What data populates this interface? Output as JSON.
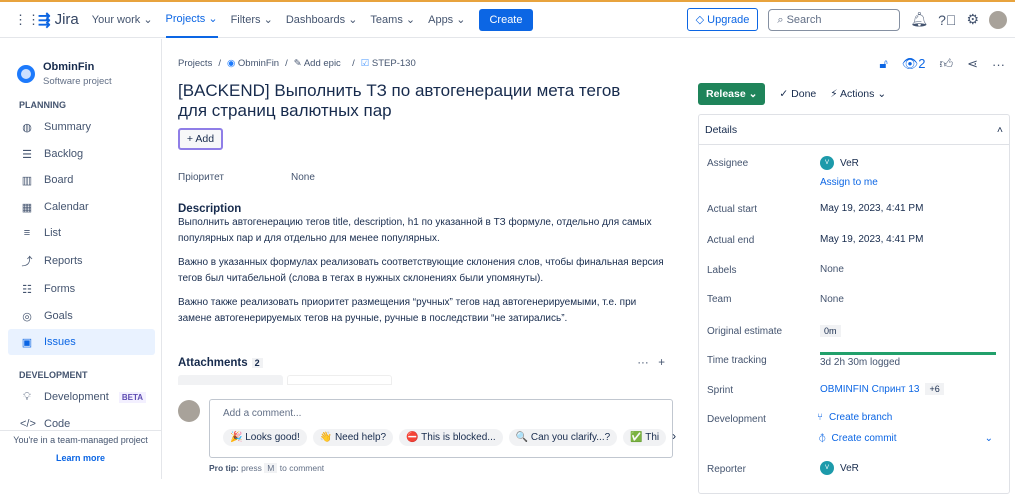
{
  "nav": {
    "product": "Jira",
    "items": [
      "Your work",
      "Projects",
      "Filters",
      "Dashboards",
      "Teams",
      "Apps"
    ],
    "active": "Projects",
    "create": "Create",
    "upgrade": "Upgrade",
    "search_placeholder": "Search"
  },
  "sidebar": {
    "project_name": "ObminFin",
    "project_type": "Software project",
    "planning": "PLANNING",
    "items": [
      "Summary",
      "Backlog",
      "Board",
      "Calendar",
      "List",
      "Reports",
      "Forms",
      "Goals",
      "Issues"
    ],
    "selected": "Issues",
    "development": "DEVELOPMENT",
    "dev_items": [
      "Development",
      "Code"
    ],
    "beta": "BETA",
    "footer": "You're in a team-managed project",
    "learn_more": "Learn more"
  },
  "breadcrumb": [
    "Projects",
    "ObminFin",
    "Add epic",
    "STEP-130"
  ],
  "issue": {
    "title": "[BACKEND] Выполнить ТЗ по автогенерации мета тегов для страниц валютных пар",
    "add": "Add",
    "priority_label": "Пріоритет",
    "priority_value": "None",
    "description_label": "Description",
    "description": [
      "Выполнить автогенерацию тегов title, description, h1 по указанной в ТЗ формуле, отдельно для самых популярных пар и для отдельно для менее популярных.",
      "Важно в указанных формулах реализовать соответствующие склонения слов, чтобы финальная версия тегов был читабельной (слова в тегах  в нужных склонениях были упомянуты).",
      "Важно также реализовать приоритет размещения “ручных” тегов над автогенерируемыми, т.е. при замене автогенерируемых тегов на ручные, ручные в последствии “не затирались”."
    ],
    "attachments_label": "Attachments",
    "attachments_count": "2"
  },
  "comment": {
    "placeholder": "Add a comment...",
    "chips": [
      "🎉 Looks good!",
      "👋 Need help?",
      "⛔ This is blocked...",
      "🔍 Can you clarify...?",
      "✅ Thi"
    ],
    "tip_bold": "Pro tip:",
    "tip_press": "press",
    "tip_key": "M",
    "tip_rest": "to comment"
  },
  "toolbar": {
    "watchers": "2",
    "release": "Release",
    "done": "Done",
    "actions": "Actions"
  },
  "details": {
    "header": "Details",
    "assignee_label": "Assignee",
    "assignee": "VeR",
    "avatar_initial": "V",
    "assign_to_me": "Assign to me",
    "start_label": "Actual start",
    "start": "May 19, 2023, 4:41 PM",
    "end_label": "Actual end",
    "end": "May 19, 2023, 4:41 PM",
    "labels_label": "Labels",
    "labels": "None",
    "team_label": "Team",
    "team": "None",
    "estimate_label": "Original estimate",
    "estimate": "0m",
    "tracking_label": "Time tracking",
    "tracking": "3d 2h 30m logged",
    "tracking_progress": 1.0,
    "sprint_label": "Sprint",
    "sprint": "OBMINFIN Спринт 13",
    "sprint_more": "+6",
    "dev_label": "Development",
    "create_branch": "Create branch",
    "create_commit": "Create commit",
    "reporter_label": "Reporter",
    "reporter": "VeR"
  },
  "colors": {
    "accent": "#0c66e4",
    "release": "#1f845a",
    "selected_bg": "#e9f2ff"
  }
}
